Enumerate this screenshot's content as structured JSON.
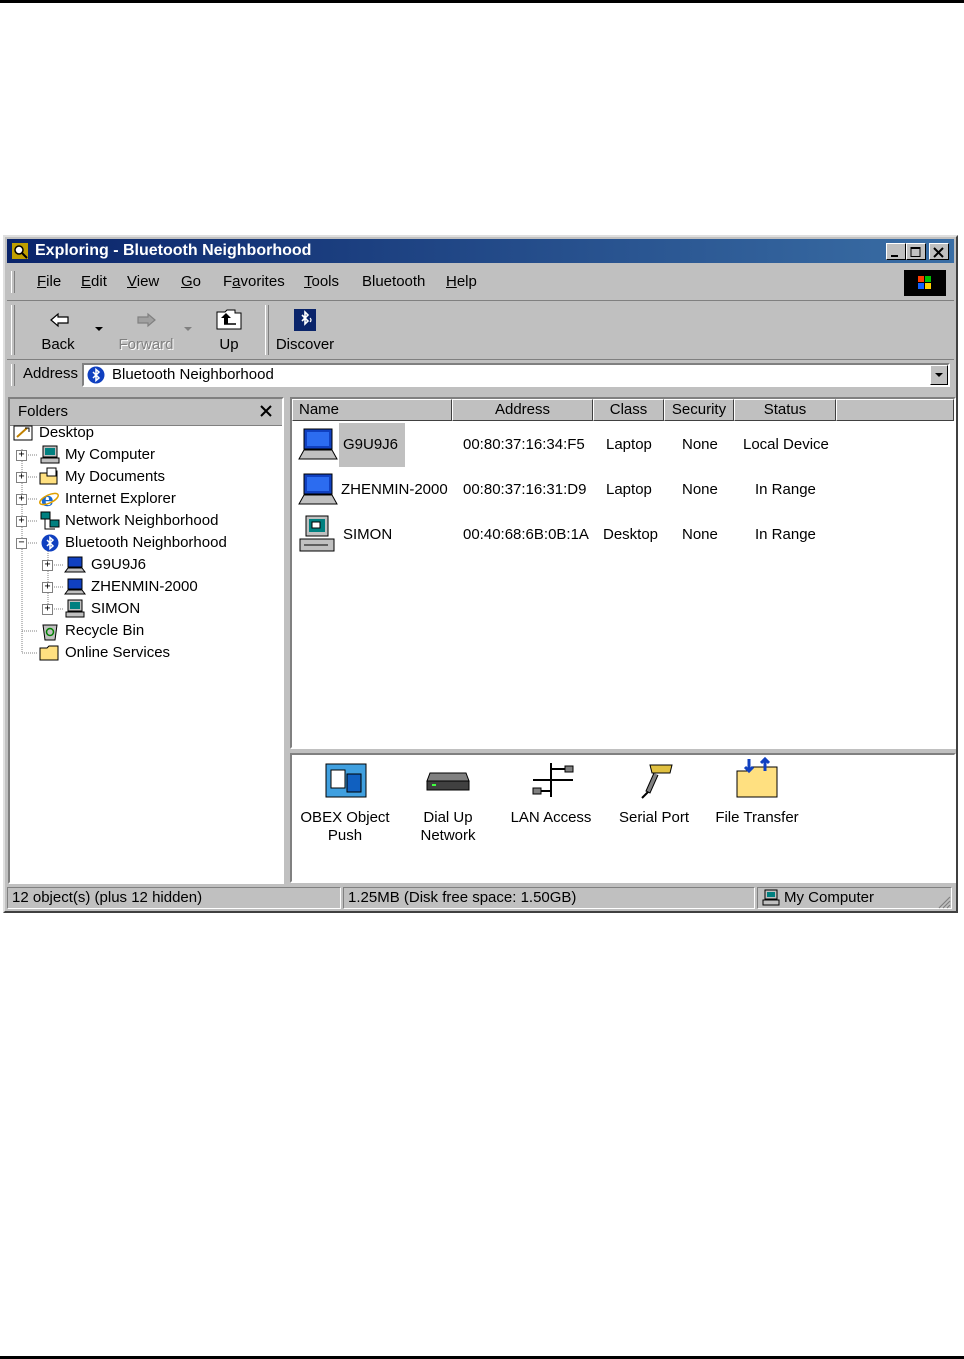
{
  "window": {
    "title": "Exploring - Bluetooth Neighborhood",
    "controls": [
      "minimize",
      "maximize",
      "close"
    ]
  },
  "menu": {
    "items": [
      {
        "label": "File",
        "mnemonic": "F"
      },
      {
        "label": "Edit",
        "mnemonic": "E"
      },
      {
        "label": "View",
        "mnemonic": "V"
      },
      {
        "label": "Go",
        "mnemonic": "G"
      },
      {
        "label": "Favorites",
        "mnemonic": "a"
      },
      {
        "label": "Tools",
        "mnemonic": "T"
      },
      {
        "label": "Bluetooth",
        "mnemonic": ""
      },
      {
        "label": "Help",
        "mnemonic": "H"
      }
    ]
  },
  "toolbar": {
    "back_label": "Back",
    "forward_label": "Forward",
    "up_label": "Up",
    "discover_label": "Discover"
  },
  "address": {
    "label": "Address",
    "value": "Bluetooth Neighborhood"
  },
  "folders": {
    "title": "Folders",
    "tree": [
      {
        "label": "Desktop",
        "icon": "desktop-icon"
      },
      {
        "label": "My Computer",
        "icon": "computer-icon"
      },
      {
        "label": "My Documents",
        "icon": "documents-folder-icon"
      },
      {
        "label": "Internet Explorer",
        "icon": "internet-explorer-icon"
      },
      {
        "label": "Network Neighborhood",
        "icon": "network-icon"
      },
      {
        "label": "Bluetooth Neighborhood",
        "icon": "bluetooth-icon"
      },
      {
        "label": "G9U9J6",
        "icon": "laptop-icon"
      },
      {
        "label": "ZHENMIN-2000",
        "icon": "laptop-icon"
      },
      {
        "label": "SIMON",
        "icon": "desktop-computer-icon"
      },
      {
        "label": "Recycle Bin",
        "icon": "recycle-bin-icon"
      },
      {
        "label": "Online Services",
        "icon": "folder-icon"
      }
    ]
  },
  "list": {
    "columns": [
      "Name",
      "Address",
      "Class",
      "Security",
      "Status"
    ],
    "rows": [
      {
        "name": "G9U9J6",
        "address": "00:80:37:16:34:F5",
        "class": "Laptop",
        "security": "None",
        "status": "Local Device",
        "icon": "laptop-icon"
      },
      {
        "name": "ZHENMIN-2000",
        "address": "00:80:37:16:31:D9",
        "class": "Laptop",
        "security": "None",
        "status": "In Range",
        "icon": "laptop-icon"
      },
      {
        "name": "SIMON",
        "address": "00:40:68:6B:0B:1A",
        "class": "Desktop",
        "security": "None",
        "status": "In Range",
        "icon": "desktop-computer-icon"
      }
    ]
  },
  "services": [
    {
      "label_line1": "OBEX Object",
      "label_line2": "Push",
      "icon": "obex-icon"
    },
    {
      "label_line1": "Dial Up",
      "label_line2": "Network",
      "icon": "modem-icon"
    },
    {
      "label_line1": "LAN Access",
      "label_line2": "",
      "icon": "lan-icon"
    },
    {
      "label_line1": "Serial Port",
      "label_line2": "",
      "icon": "serial-port-icon"
    },
    {
      "label_line1": "File Transfer",
      "label_line2": "",
      "icon": "file-transfer-icon"
    }
  ],
  "status": {
    "objects": "12 object(s) (plus 12 hidden)",
    "size": "1.25MB (Disk free space: 1.50GB)",
    "zone": "My Computer"
  },
  "colors": {
    "titlebar_start": "#0a246a",
    "titlebar_end": "#3a6ea5",
    "face": "#c0c0c0",
    "selection": "#c0c0c0"
  }
}
